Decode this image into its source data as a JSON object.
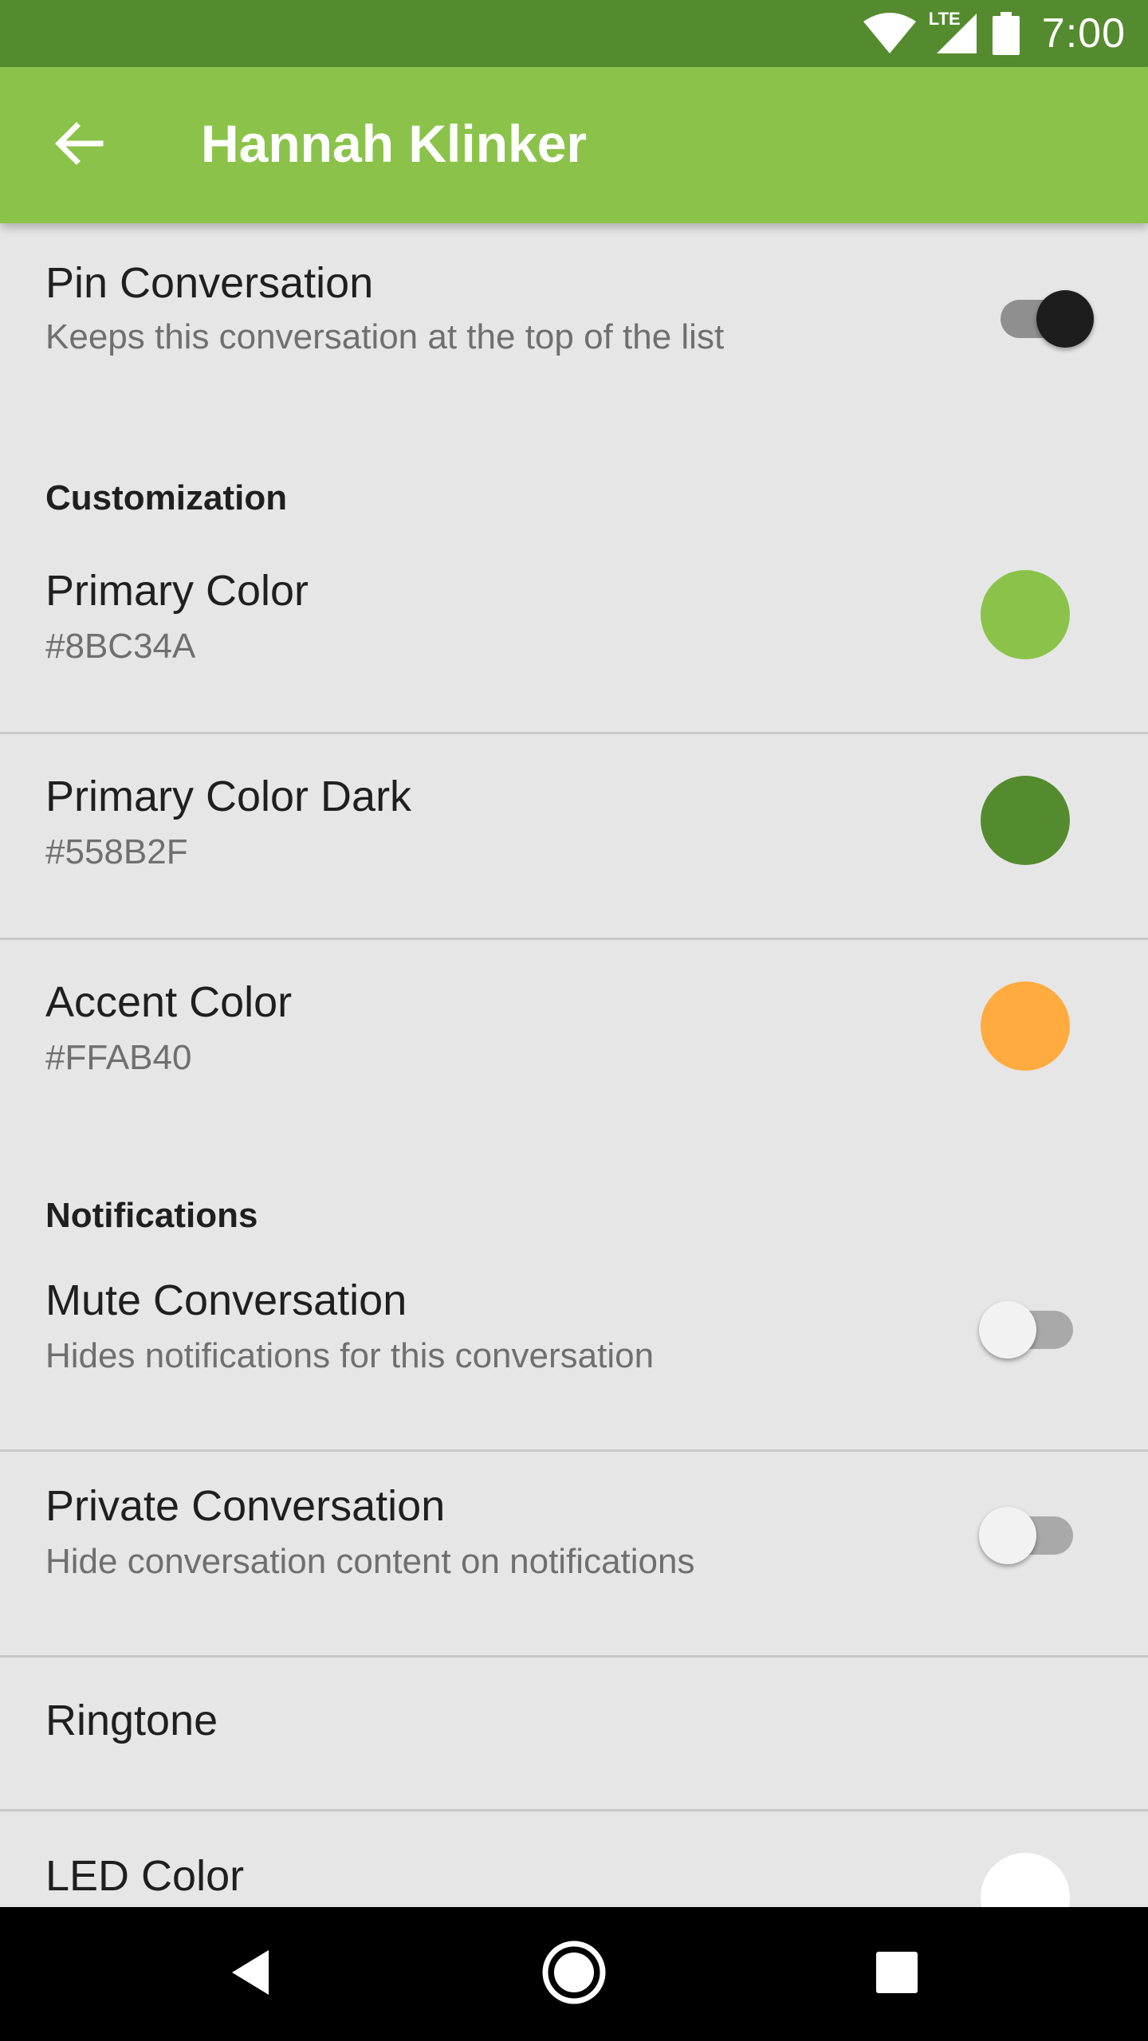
{
  "status_bar": {
    "time": "7:00",
    "network_label": "LTE",
    "icons": [
      "wifi-icon",
      "cell-signal-icon",
      "battery-icon"
    ]
  },
  "app_bar": {
    "title": "Hannah Klinker",
    "back_icon": "arrow-back-icon",
    "color": "#8BC34A",
    "status_color": "#558B2F"
  },
  "settings": {
    "pin": {
      "title": "Pin Conversation",
      "summary": "Keeps this conversation at the top of the list",
      "enabled": true
    },
    "customization_header": "Customization",
    "primary_color": {
      "title": "Primary Color",
      "value": "#8BC34A",
      "swatch": "#8BC34A"
    },
    "primary_color_dark": {
      "title": "Primary Color Dark",
      "value": "#558B2F",
      "swatch": "#558B2F"
    },
    "accent_color": {
      "title": "Accent Color",
      "value": "#FFAB40",
      "swatch": "#FFAB40"
    },
    "notifications_header": "Notifications",
    "mute": {
      "title": "Mute Conversation",
      "summary": "Hides notifications for this conversation",
      "enabled": false
    },
    "private": {
      "title": "Private Conversation",
      "summary": "Hide conversation content on notifications",
      "enabled": false
    },
    "ringtone": {
      "title": "Ringtone"
    },
    "led_color": {
      "title": "LED Color",
      "swatch": "#FFFFFF"
    }
  },
  "nav_bar": {
    "back_icon": "nav-back-icon",
    "home_icon": "nav-home-icon",
    "recents_icon": "nav-recents-icon"
  }
}
